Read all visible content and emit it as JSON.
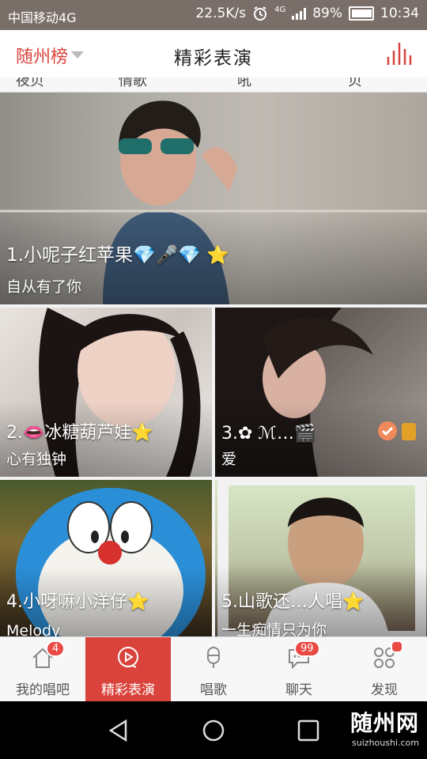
{
  "status_bar": {
    "carrier": "中国移动4G",
    "speed": "22.5K/s",
    "network": "4G",
    "battery": "89%",
    "battery_level": 0.89,
    "time": "10:34"
  },
  "header": {
    "rank_selector": "随州榜",
    "title": "精彩表演"
  },
  "category_strip": [
    "夜贝",
    "情歌",
    "吼",
    "贝"
  ],
  "performances": [
    {
      "name": "1.小呢子红苹果💎🎤💎 ⭐",
      "tag": "自从有了你"
    },
    {
      "name": "2.👄冰糖葫芦娃⭐",
      "tag": "心有独钟"
    },
    {
      "name": "3.✿ ℳ…🎬",
      "tag": "爱"
    },
    {
      "name": "4.小呀嘛小洋仔⭐",
      "tag": "Melody"
    },
    {
      "name": "5.山歌还…人唱⭐",
      "tag": "一生痴情只为你"
    }
  ],
  "tabs": [
    {
      "label": "我的唱吧",
      "icon": "home-icon",
      "badge": "4"
    },
    {
      "label": "精彩表演",
      "icon": "play-icon",
      "active": true
    },
    {
      "label": "唱歌",
      "icon": "microphone-icon"
    },
    {
      "label": "聊天",
      "icon": "chat-icon",
      "badge": "99"
    },
    {
      "label": "发现",
      "icon": "discover-icon",
      "dot": true
    }
  ],
  "watermark": {
    "text": "随州网",
    "url": "suizhoushi.com"
  },
  "colors": {
    "accent": "#d9433b",
    "badge": "#e94a44"
  }
}
